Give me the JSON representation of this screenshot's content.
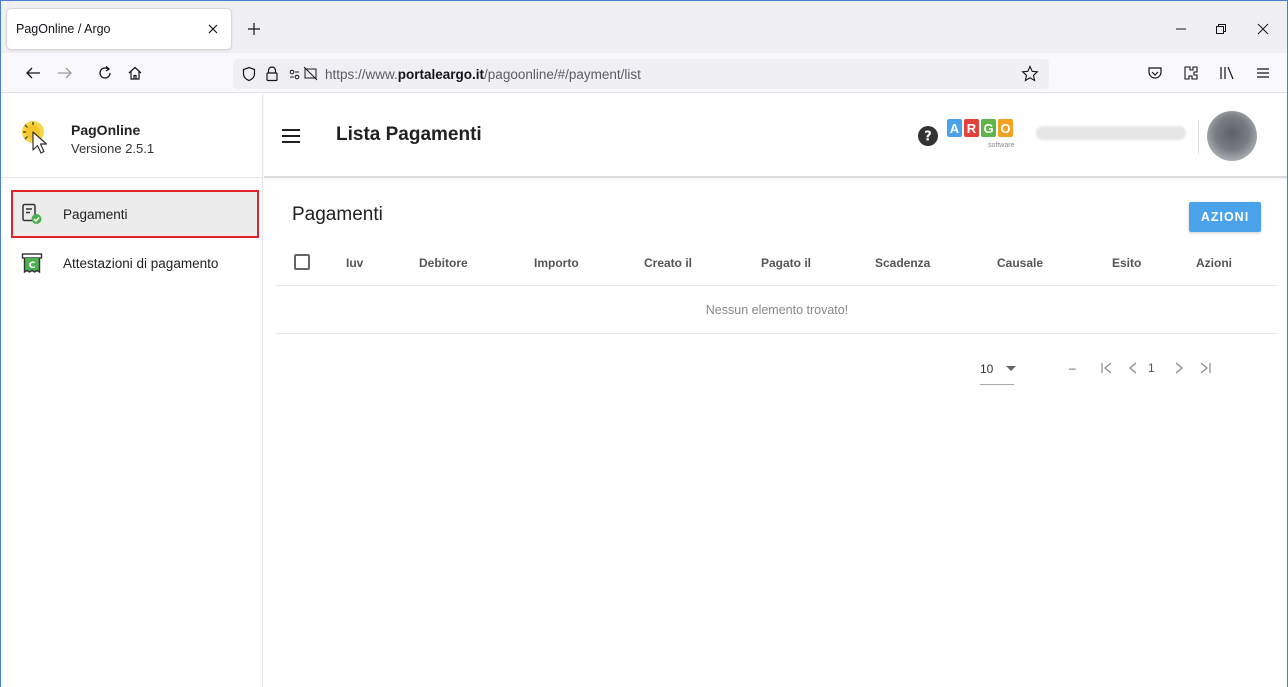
{
  "browser": {
    "tab_title": "PagOnline / Argo",
    "url_prefix": "https://www.",
    "url_domain": "portaleargo.it",
    "url_path": "/pagoonline/#/payment/list"
  },
  "sidebar": {
    "app_name": "PagOnline",
    "version": "Versione 2.5.1",
    "items": [
      {
        "label": "Pagamenti",
        "icon": "payment-list-check-icon",
        "active": true
      },
      {
        "label": "Attestazioni di pagamento",
        "icon": "receipt-icon",
        "active": false
      }
    ]
  },
  "toolbar": {
    "title": "Lista Pagamenti",
    "brand_letters": [
      "A",
      "R",
      "G",
      "O"
    ],
    "brand_colors": [
      "#4aa3ea",
      "#e2403a",
      "#5fb548",
      "#f2a21f"
    ],
    "brand_sub": "software"
  },
  "content": {
    "section_title": "Pagamenti",
    "actions_label": "AZIONI",
    "columns": [
      "Iuv",
      "Debitore",
      "Importo",
      "Creato il",
      "Pagato il",
      "Scadenza",
      "Causale",
      "Esito",
      "Azioni"
    ],
    "empty_message": "Nessun elemento trovato!",
    "pagination": {
      "page_size": "10",
      "range": "–",
      "current_page": "1"
    }
  },
  "colors": {
    "accent": "#4aa3ea",
    "highlight": "#e1232b"
  }
}
